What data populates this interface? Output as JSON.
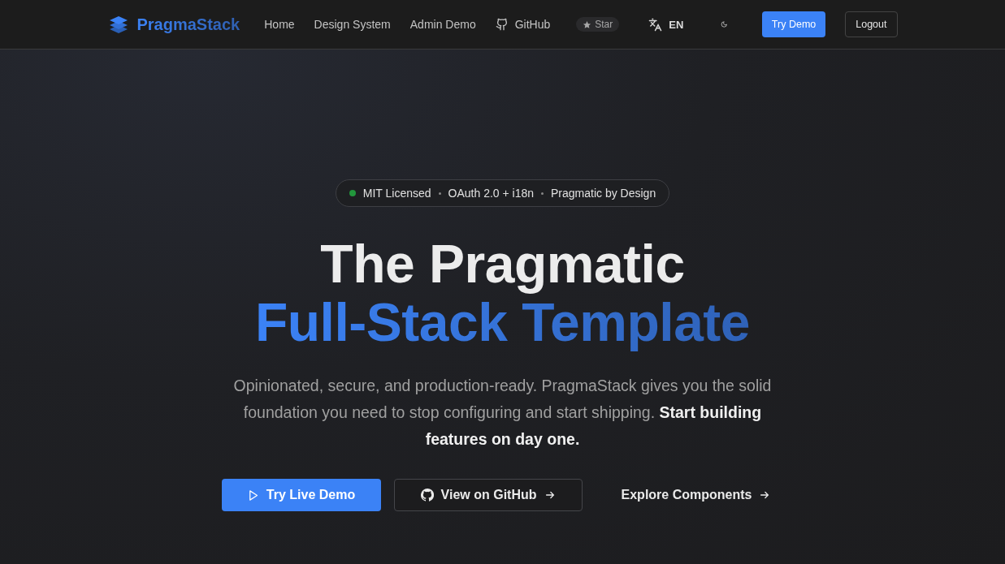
{
  "header": {
    "brand": "PragmaStack",
    "nav": [
      {
        "label": "Home",
        "kind": "link"
      },
      {
        "label": "Design System",
        "kind": "link"
      },
      {
        "label": "Admin Demo",
        "kind": "link"
      },
      {
        "label": "GitHub",
        "kind": "github"
      }
    ],
    "star_badge": "Star",
    "language": "EN",
    "buttons": [
      {
        "label": "Try Demo",
        "kind": "primary"
      },
      {
        "label": "Logout",
        "kind": "outline"
      }
    ]
  },
  "hero": {
    "badge": [
      {
        "label": "MIT Licensed",
        "color": "#22963c"
      },
      {
        "label": "OAuth 2.0 + i18n"
      },
      {
        "label": "Pragmatic by Design"
      }
    ],
    "title_line_1": "The Pragmatic",
    "title_line_2": "Full-Stack Template",
    "description": "Opinionated, secure, and production-ready. PragmaStack gives you the solid foundation you need to stop configuring and start shipping. **Start building features on day one.**",
    "actions": [
      {
        "label": "Try Live Demo",
        "kind": "primary"
      },
      {
        "label": "View on GitHub",
        "kind": "outline"
      },
      {
        "label": "Explore Components",
        "kind": "link"
      }
    ]
  }
}
